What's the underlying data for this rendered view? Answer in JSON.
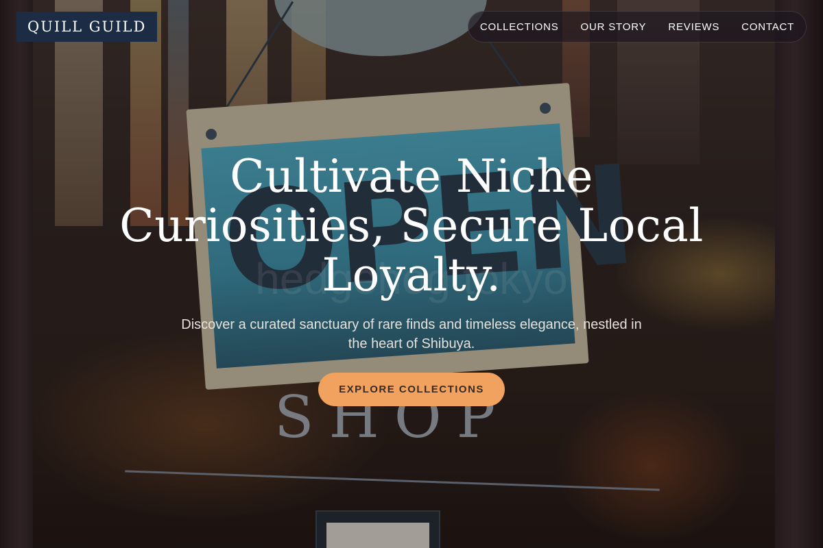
{
  "brand": {
    "name": "QUILL GUILD"
  },
  "nav": {
    "items": [
      {
        "label": "COLLECTIONS"
      },
      {
        "label": "OUR STORY"
      },
      {
        "label": "REVIEWS"
      },
      {
        "label": "CONTACT"
      }
    ]
  },
  "hero": {
    "title": "Cultivate Niche Curiosities, Secure Local Loyalty.",
    "subtitle": "Discover a curated sanctuary of rare finds and timeless elegance, nestled in the heart of Shibuya.",
    "cta_label": "EXPLORE COLLECTIONS",
    "background": {
      "sign_text": "OPEN",
      "door_text": "SHOP",
      "watermark": "hedgehog tokyo"
    }
  },
  "colors": {
    "brand_bg": "#1d2c45",
    "cta_bg": "#f0a25e",
    "text": "#ffffff"
  }
}
